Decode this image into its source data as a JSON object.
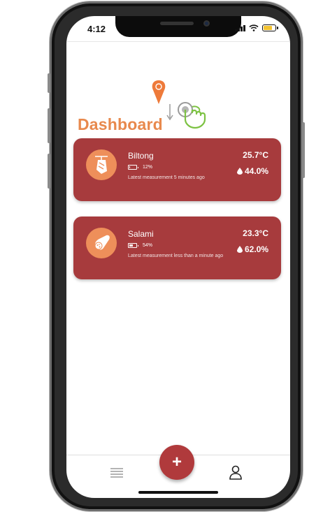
{
  "status_bar": {
    "time": "4:12"
  },
  "page": {
    "title": "Dashboard"
  },
  "devices": [
    {
      "name": "Biltong",
      "battery_percent": "12%",
      "battery_level": 0.12,
      "latest": "Latest measurement 5 minutes ago",
      "temperature": "25.7°C",
      "humidity": "44.0%",
      "icon": "biltong-icon"
    },
    {
      "name": "Salami",
      "battery_percent": "54%",
      "battery_level": 0.54,
      "latest": "Latest measurement less than a minute ago",
      "temperature": "23.3°C",
      "humidity": "62.0%",
      "icon": "salami-icon"
    }
  ],
  "nav": {
    "add_label": "+",
    "menu_icon": "menu-icon",
    "user_icon": "user-icon"
  },
  "colors": {
    "card": "#a73b3d",
    "accent": "#e8894d",
    "avatar": "#ee8f5a",
    "fab": "#b03a3c"
  }
}
